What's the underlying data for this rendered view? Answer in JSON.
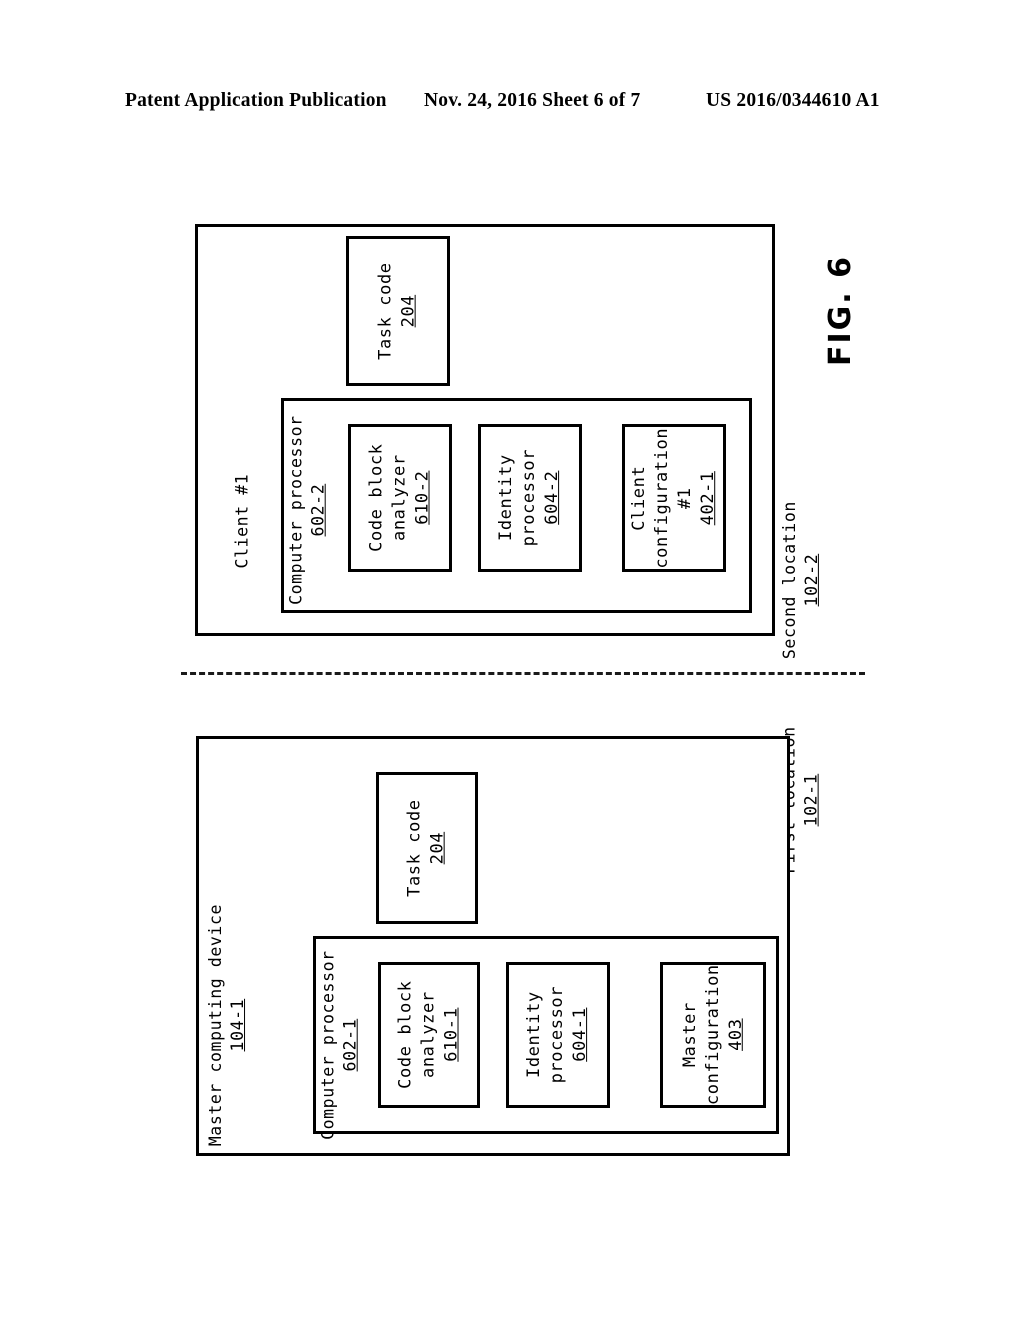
{
  "header": {
    "publication": "Patent Application Publication",
    "date_sheet": "Nov. 24, 2016  Sheet 6 of 7",
    "patent_number": "US 2016/0344610 A1"
  },
  "figure": {
    "number_label": "FIG. 6",
    "second_location": {
      "label": "Second location",
      "ref": "102‑2"
    },
    "first_location": {
      "label": "First location",
      "ref": "102‑1"
    },
    "client_block": {
      "title": "Client #1",
      "task_code": {
        "label": "Task code",
        "ref": "204"
      },
      "computer_processor": {
        "label": "Computer processor",
        "ref": "602‑2"
      },
      "code_block_analyzer": {
        "line1": "Code block",
        "line2": "analyzer",
        "ref": "610‑2"
      },
      "identity_processor": {
        "line1": "Identity",
        "line2": "processor",
        "ref": "604‑2"
      },
      "client_configuration": {
        "line1": "Client",
        "line2": "configuration",
        "line3": "#1",
        "ref": "402‑1"
      }
    },
    "master_block": {
      "title_line1": "Master computing device",
      "title_ref": "104‑1",
      "task_code": {
        "label": "Task code",
        "ref": "204"
      },
      "computer_processor": {
        "label": "Computer processor",
        "ref": "602‑1"
      },
      "code_block_analyzer": {
        "line1": "Code block",
        "line2": "analyzer",
        "ref": "610‑1"
      },
      "identity_processor": {
        "line1": "Identity",
        "line2": "processor",
        "ref": "604‑1"
      },
      "master_configuration": {
        "line1": "Master",
        "line2": "configuration",
        "ref": "403"
      }
    }
  },
  "colors": {
    "ink": "#000000",
    "paper": "#ffffff"
  }
}
